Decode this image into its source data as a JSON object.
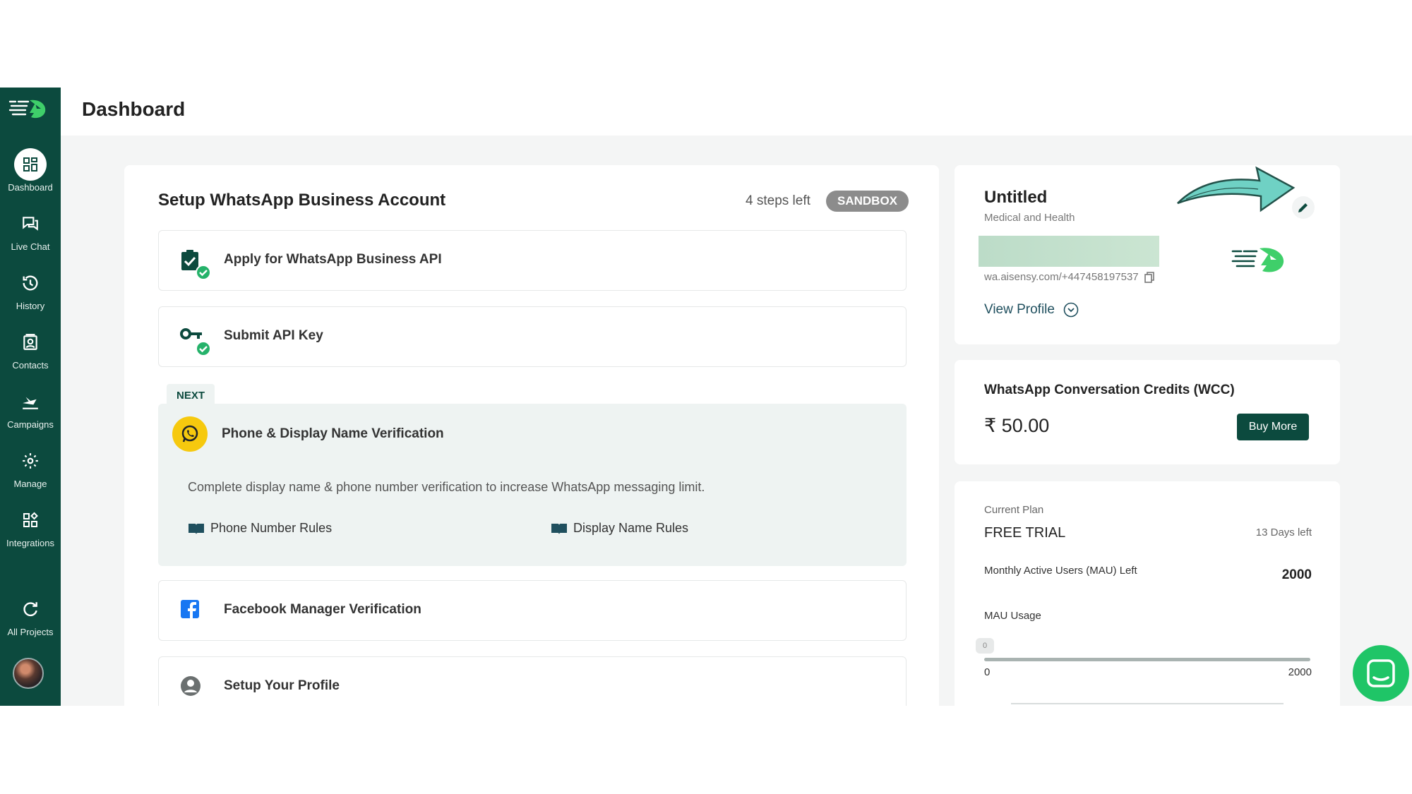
{
  "sidebar": {
    "items": [
      {
        "label": "Dashboard",
        "icon": "dashboard-icon"
      },
      {
        "label": "Live Chat",
        "icon": "chat-icon"
      },
      {
        "label": "History",
        "icon": "history-icon"
      },
      {
        "label": "Contacts",
        "icon": "contacts-icon"
      },
      {
        "label": "Campaigns",
        "icon": "send-icon"
      },
      {
        "label": "Manage",
        "icon": "gear-icon"
      },
      {
        "label": "Integrations",
        "icon": "integrations-icon"
      },
      {
        "label": "All Projects",
        "icon": "refresh-icon"
      }
    ]
  },
  "header": {
    "title": "Dashboard"
  },
  "setup": {
    "title": "Setup WhatsApp Business Account",
    "steps_left": "4 steps left",
    "badge": "SANDBOX",
    "steps": [
      {
        "label": "Apply for WhatsApp Business API",
        "done": true
      },
      {
        "label": "Submit API Key",
        "done": true
      }
    ],
    "next": {
      "tag": "NEXT",
      "title": "Phone & Display Name Verification",
      "description": "Complete display name & phone number verification to increase WhatsApp messaging limit.",
      "links": [
        "Phone Number Rules",
        "Display Name Rules"
      ]
    },
    "pending": [
      {
        "label": "Facebook Manager Verification"
      },
      {
        "label": "Setup Your Profile"
      }
    ]
  },
  "profile": {
    "name": "Untitled",
    "category": "Medical and Health",
    "link": "wa.aisensy.com/+447458197537",
    "view_label": "View Profile"
  },
  "credits": {
    "title": "WhatsApp Conversation Credits (WCC)",
    "amount": "₹ 50.00",
    "button": "Buy More"
  },
  "plan": {
    "caption": "Current Plan",
    "name": "FREE TRIAL",
    "days_left": "13 Days left",
    "mau_label": "Monthly Active Users (MAU) Left",
    "mau_value": "2000",
    "usage_label": "MAU Usage",
    "usage_value": "0",
    "usage_min": "0",
    "usage_max": "2000"
  },
  "colors": {
    "brand": "#0c4a3e",
    "accent_green": "#25b26a",
    "chat_fab": "#1fc567",
    "whatsapp_yellow": "#f6c90e",
    "facebook_blue": "#1877f2"
  }
}
